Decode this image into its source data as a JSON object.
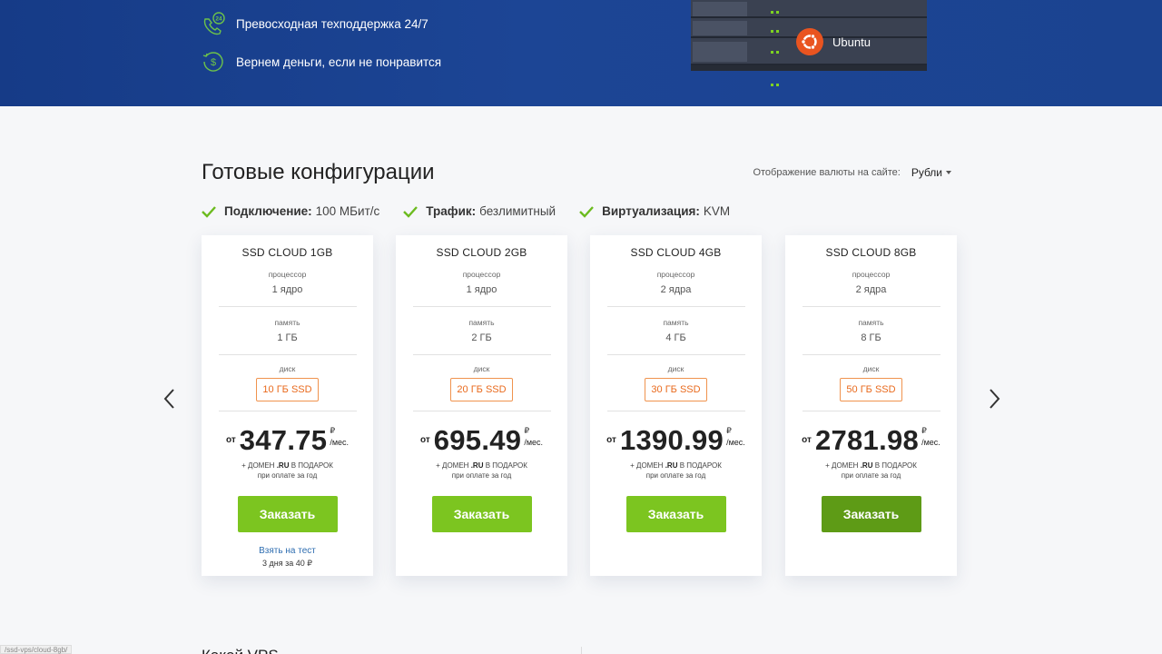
{
  "hero": {
    "features": [
      {
        "icon": "phone-24-icon",
        "text": "Превосходная техподдержка 24/7"
      },
      {
        "icon": "money-back-icon",
        "text": "Вернем деньги, если не понравится"
      }
    ],
    "os_label": "Ubuntu",
    "colors": {
      "band": "#1c4595",
      "accent_green": "#7ed321",
      "ubuntu": "#e95420"
    }
  },
  "section": {
    "title": "Готовые конфигурации",
    "currency_label": "Отображение валюты на сайте:",
    "currency_value": "Рубли"
  },
  "features": [
    {
      "label": "Подключение:",
      "value": "100 МБит/с"
    },
    {
      "label": "Трафик:",
      "value": "безлимитный"
    },
    {
      "label": "Виртуализация:",
      "value": "KVM"
    }
  ],
  "card_labels": {
    "cpu": "процессор",
    "ram": "память",
    "disk": "диск",
    "from": "от",
    "currency": "₽",
    "per": "/мес.",
    "gift_line1_pre": "+ ДОМЕН",
    "gift_domain": ".RU",
    "gift_line1_post": "В ПОДАРОК",
    "gift_line2": "при оплате за год",
    "order": "Заказать",
    "trial_link": "Взять на тест",
    "trial_note": "3 дня за 40 ₽"
  },
  "plans": [
    {
      "name": "SSD CLOUD 1GB",
      "cpu": "1 ядро",
      "ram": "1 ГБ",
      "disk": "10 ГБ SSD",
      "price": "347.75"
    },
    {
      "name": "SSD CLOUD 2GB",
      "cpu": "1 ядро",
      "ram": "2 ГБ",
      "disk": "20 ГБ SSD",
      "price": "695.49"
    },
    {
      "name": "SSD CLOUD 4GB",
      "cpu": "2 ядра",
      "ram": "4 ГБ",
      "disk": "30 ГБ SSD",
      "price": "1390.99"
    },
    {
      "name": "SSD CLOUD 8GB",
      "cpu": "2 ядра",
      "ram": "8 ГБ",
      "disk": "50 ГБ SSD",
      "price": "2781.98"
    }
  ],
  "colors": {
    "order_button": "#7cc520",
    "order_button_hover": "#5e9b16",
    "disk_badge": "#e96a1d",
    "check": "#6cbb1f",
    "link": "#2e6db0"
  },
  "bottom": {
    "title_partial": "Какой VPS",
    "status_url": "/ssd-vps/cloud-8gb/"
  }
}
